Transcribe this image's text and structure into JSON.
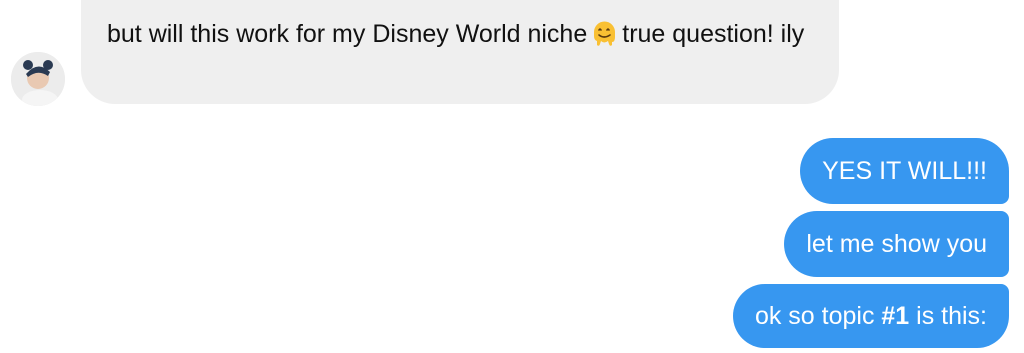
{
  "incoming": {
    "text_before_emoji": "but will this work for my Disney World niche",
    "emoji": "melting-face-emoji",
    "text_after_emoji": "true question! ily"
  },
  "outgoing": {
    "message_1": "YES IT WILL!!!",
    "message_2": "let me show you",
    "message_3_prefix": "ok so topic ",
    "message_3_bold": "#1",
    "message_3_suffix": " is this:"
  },
  "colors": {
    "incoming_bubble": "#efefef",
    "outgoing_bubble": "#3797f0",
    "incoming_text": "#111111",
    "outgoing_text": "#ffffff"
  }
}
